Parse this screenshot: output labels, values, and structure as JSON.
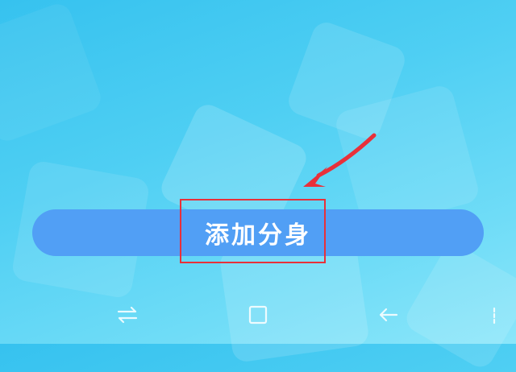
{
  "main": {
    "add_clone_label": "添加分身"
  },
  "nav_bar": {
    "icons": [
      "switch-apps-icon",
      "home-icon",
      "back-icon",
      "menu-icon"
    ]
  },
  "colors": {
    "background": "#4fcff3",
    "button": "#519ff5",
    "highlight": "#e8303a"
  }
}
